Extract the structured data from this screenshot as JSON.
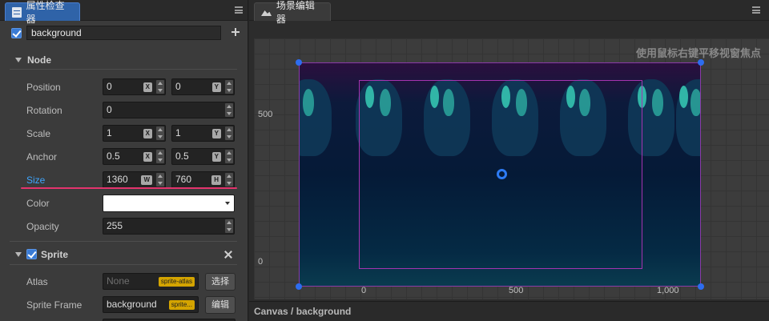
{
  "inspector": {
    "tab_title": "属性检查器",
    "node_name": "background",
    "node_section": "Node",
    "position": {
      "label": "Position",
      "x": "0",
      "y": "0",
      "x_tag": "X",
      "y_tag": "Y"
    },
    "rotation": {
      "label": "Rotation",
      "value": "0"
    },
    "scale": {
      "label": "Scale",
      "x": "1",
      "y": "1",
      "x_tag": "X",
      "y_tag": "Y"
    },
    "anchor": {
      "label": "Anchor",
      "x": "0.5",
      "y": "0.5",
      "x_tag": "X",
      "y_tag": "Y"
    },
    "size": {
      "label": "Size",
      "w": "1360",
      "h": "760",
      "w_tag": "W",
      "h_tag": "H"
    },
    "color": {
      "label": "Color",
      "value": "#ffffff"
    },
    "opacity": {
      "label": "Opacity",
      "value": "255"
    },
    "sprite_section": "Sprite",
    "atlas": {
      "label": "Atlas",
      "value": "None",
      "tag": "sprite-atlas",
      "button": "选择"
    },
    "sprite_frame": {
      "label": "Sprite Frame",
      "value": "background",
      "tag": "sprite...",
      "button": "编辑"
    }
  },
  "scene": {
    "tab_title": "场景编辑器",
    "hint": "使用鼠标右键平移视窗焦点",
    "ruler_y": [
      "500",
      "0"
    ],
    "ruler_x": [
      "0",
      "500",
      "1,000"
    ],
    "breadcrumb": "Canvas / background"
  },
  "colors": {
    "accent": "#2f63a8",
    "size_highlight": "#e3346d",
    "selection_border": "#a533b0",
    "handle": "#2d6df0",
    "asset_tag": "#d4a400"
  }
}
